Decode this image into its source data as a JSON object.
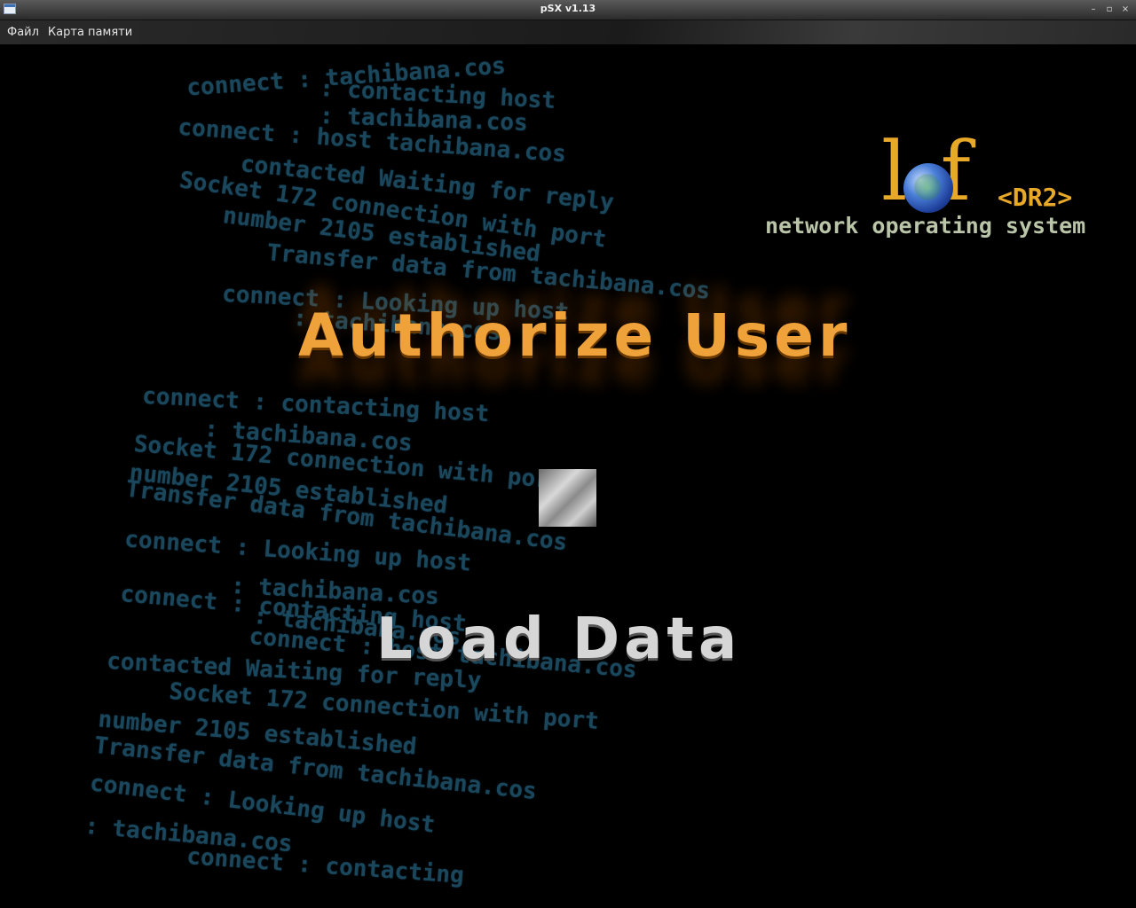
{
  "window": {
    "title": "pSX v1.13",
    "buttons": {
      "minimize": "–",
      "restore": "▫",
      "close": "×"
    }
  },
  "menubar": {
    "items": [
      {
        "label": "Файл"
      },
      {
        "label": "Карта памяти"
      }
    ]
  },
  "game": {
    "logo": {
      "letters": "l f",
      "tag": "<DR2>",
      "subtitle": "network operating system"
    },
    "menu": {
      "option_1": "Authorize User",
      "option_2": "Load Data"
    },
    "background_lines": [
      "connect : tachibana.cos",
      ": contacting host",
      ": tachibana.cos",
      "connect : host tachibana.cos",
      "contacted Waiting for reply",
      "Socket 172 connection with port",
      "number 2105 established",
      "Transfer data from tachibana.cos",
      "connect : Looking up host",
      ": tachibana.cos",
      "connect : contacting host",
      ": tachibana.cos",
      "Socket 172 connection with port",
      "number 2105 established",
      "Transfer data from tachibana.cos",
      "connect : Looking up host",
      ": tachibana.cos",
      "connect : contacting host",
      ": tachibana.cos",
      "connect : host tachibana.cos",
      "contacted Waiting for reply",
      "Socket 172 connection with port",
      "number 2105 established",
      "Transfer data from tachibana.cos",
      "connect : Looking up host",
      ": tachibana.cos",
      "connect : contacting"
    ],
    "colors": {
      "accent_orange": "#f0a23a",
      "text_grey": "#d6d6d6",
      "background_text": "#1e4f66"
    }
  }
}
